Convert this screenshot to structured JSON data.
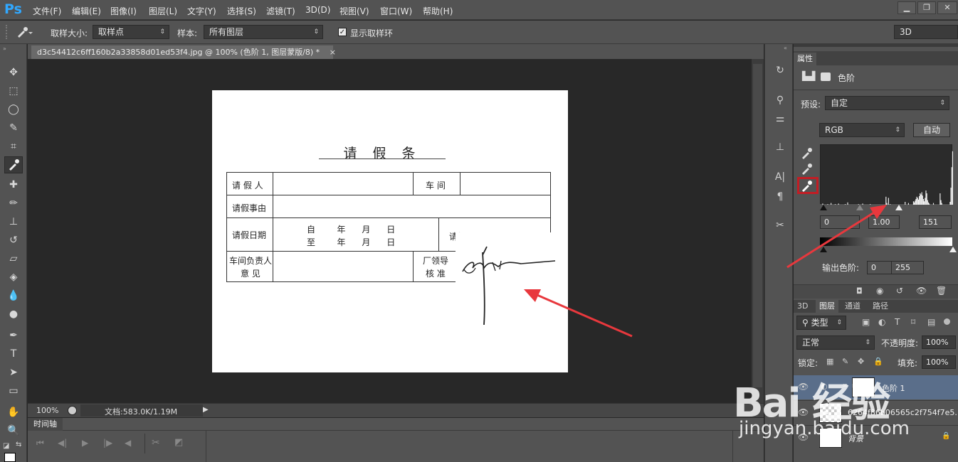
{
  "app": {
    "logo": "Ps"
  },
  "menu": [
    "文件(F)",
    "编辑(E)",
    "图像(I)",
    "图层(L)",
    "文字(Y)",
    "选择(S)",
    "滤镜(T)",
    "3D(D)",
    "视图(V)",
    "窗口(W)",
    "帮助(H)"
  ],
  "window_controls": {
    "minimize": "▁",
    "restore": "❐",
    "close": "✕"
  },
  "options": {
    "sample_size_label": "取样大小:",
    "sample_size_value": "取样点",
    "sample_label": "样本:",
    "sample_value": "所有图层",
    "show_ring_label": "显示取样环",
    "show_ring_checked": true,
    "workspace": "3D"
  },
  "document": {
    "tab_title": "d3c54412c6ff160b2a33858d01ed53f4.jpg @ 100% (色阶 1, 图层蒙版/8) *",
    "zoom": "100%",
    "doc_info": "文档:583.0K/1.19M"
  },
  "leave_form": {
    "title": "请  假  条",
    "applicant_label": "请 假 人",
    "workshop_label": "车 间",
    "reason_label": "请假事由",
    "date_label": "请假日期",
    "from_row": "自        年      月      日",
    "to_row": "至        年      月      日",
    "days_label": "请假",
    "workshop_head_label_1": "车间负责人",
    "workshop_head_label_2": "意 见",
    "factory_label_1": "厂领导",
    "factory_label_2": "核 准"
  },
  "timeline": {
    "title": "时间轴"
  },
  "properties": {
    "tab": "属性",
    "adjustment_name": "色阶",
    "preset_label": "预设:",
    "preset_value": "自定",
    "channel_value": "RGB",
    "auto_button": "自动",
    "input_black": "0",
    "input_gamma": "1.00",
    "input_white": "151",
    "output_label": "输出色阶:",
    "output_black": "0",
    "output_white": "255"
  },
  "layers_panel": {
    "tabs": [
      "3D",
      "图层",
      "通道",
      "路径"
    ],
    "active_tab": "图层",
    "filter_value": "类型",
    "blend_mode": "正常",
    "opacity_label": "不透明度:",
    "opacity_value": "100%",
    "lock_label": "锁定:",
    "fill_label": "填充:",
    "fill_value": "100%",
    "layers": [
      {
        "name": "色阶 1"
      },
      {
        "name": "6264f86b06565c2f754f7e5..."
      },
      {
        "name": "背景"
      }
    ]
  },
  "watermark": {
    "brand": "Bai 经验",
    "url": "jingyan.baidu.com"
  },
  "colors": {
    "accent_red": "#e8383d",
    "ps_blue": "#31a8ff",
    "panel": "#535353",
    "canvas_bg": "#282828",
    "selected_layer": "#5a6e8a"
  },
  "histogram": [
    0,
    0,
    2,
    0,
    0,
    0,
    0,
    0,
    1,
    0,
    0,
    0,
    3,
    0,
    0,
    0,
    0,
    1,
    0,
    0,
    0,
    2,
    0,
    0,
    0,
    0,
    0,
    0,
    0,
    1,
    0,
    0,
    4,
    0,
    0,
    0,
    0,
    0,
    0,
    0,
    0,
    0,
    0,
    0,
    0,
    1,
    0,
    0,
    0,
    0,
    2,
    0,
    0,
    0,
    0,
    0,
    0,
    0,
    0,
    1,
    0,
    0,
    0,
    0,
    0,
    0,
    0,
    0,
    0,
    0,
    0,
    0,
    0,
    0,
    0,
    0,
    0,
    0,
    14,
    3,
    0,
    12,
    0,
    1,
    0,
    0,
    0,
    0,
    0,
    0,
    0,
    0,
    0,
    0,
    0,
    0,
    0,
    0,
    0,
    0,
    0,
    5,
    0,
    0,
    0,
    3,
    0,
    0,
    0,
    0,
    0,
    6,
    4,
    7,
    10,
    14,
    12,
    9,
    15,
    20,
    18,
    22,
    16,
    10,
    6,
    12,
    25,
    20,
    8,
    4,
    2,
    0,
    0,
    0,
    0,
    3,
    0,
    0,
    0,
    0,
    0,
    0,
    0,
    20,
    8,
    3,
    0,
    0,
    0,
    0,
    0,
    0,
    0,
    0,
    0,
    5,
    30,
    66,
    94
  ]
}
